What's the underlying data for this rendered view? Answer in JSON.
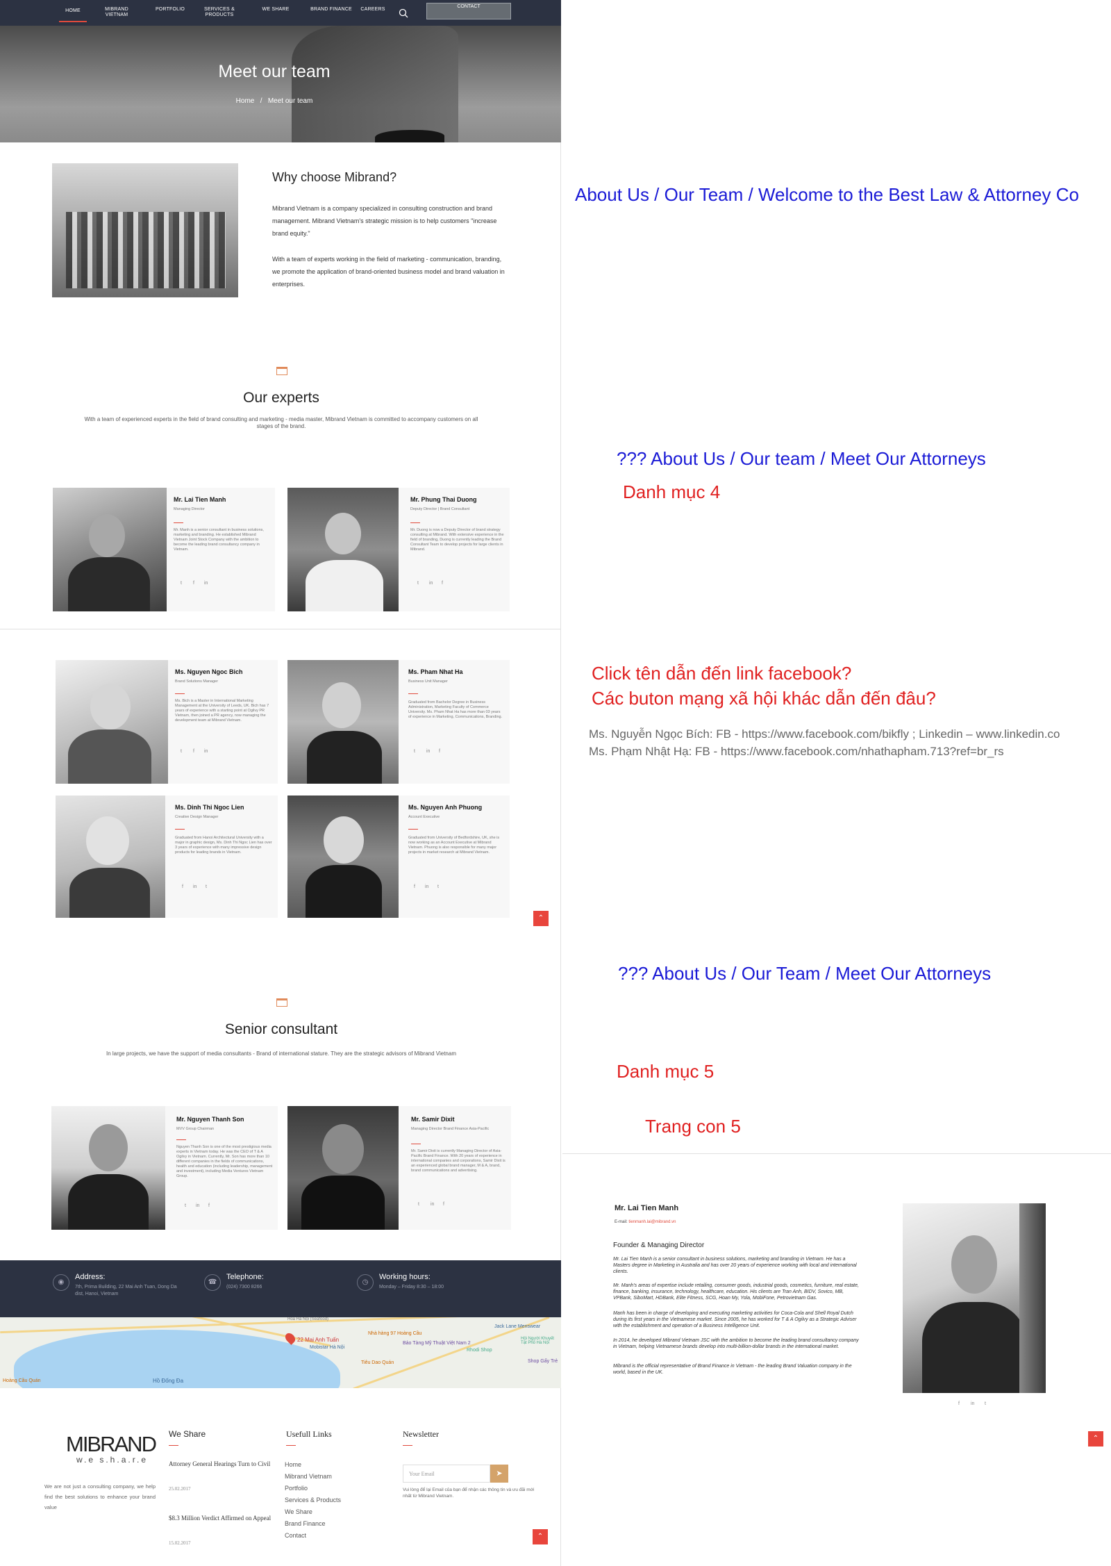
{
  "nav": {
    "items": [
      "HOME",
      "MIBRAND VIETNAM",
      "PORTFOLIO",
      "SERVICES & PRODUCTS",
      "WE SHARE",
      "BRAND FINANCE",
      "CAREERS"
    ],
    "contact": "CONTACT"
  },
  "hero": {
    "title": "Meet our team",
    "crumb_home": "Home",
    "crumb_sep": "/",
    "crumb_current": "Meet our team"
  },
  "why": {
    "title": "Why choose Mibrand?",
    "p1": "Mibrand Vietnam is a company specialized in consulting construction and brand management. Mibrand Vietnam's strategic mission is to help customers \"increase brand equity.\"",
    "p2": "With a team of experts working in the field of marketing - communication, branding, we promote the application of brand-oriented business model and brand valuation in enterprises."
  },
  "experts": {
    "title": "Our experts",
    "desc": "With a team of experienced experts in the field of brand consulting and marketing - media master, Mibrand Vietnam is committed to accompany customers on all stages of the brand.",
    "people": [
      {
        "name": "Mr. Lai Tien Manh",
        "role": "Managing Director",
        "bio": "Mr. Manh is a senior consultant in business solutions, marketing and branding. He established Mibrand Vietnam Joint Stock Company with the ambition to become the leading brand consultancy company in Vietnam.",
        "social": [
          "t",
          "f",
          "in"
        ]
      },
      {
        "name": "Mr. Phung Thai Duong",
        "role": "Deputy Director | Brand Consultant",
        "bio": "Mr. Duong is now a Deputy Director of brand strategy consulting at Mibrand. With extensive experience in the field of branding, Duong is currently leading the Brand Consultant Team to develop projects for large clients in Mibrand.",
        "social": [
          "t",
          "in",
          "f"
        ]
      },
      {
        "name": "Ms. Nguyen Ngoc Bich",
        "role": "Brand Solutions Manager",
        "bio": "Ms. Bich is a Master in International Marketing Management at the University of Leeds, UK. Bich has 7 years of experience with a starting point at Ogilvy PR Vietnam, then joined a PR agency, now managing the development team at Mibrand Vietnam.",
        "social": [
          "t",
          "f",
          "in"
        ]
      },
      {
        "name": "Ms. Pham Nhat Ha",
        "role": "Business Unit Manager",
        "bio": "Graduated from Bachelor Degree in Business Administration, Marketing Faculty of Commerce University. Ms. Pham Nhat Ha has more than 03 years of experience in Marketing, Communications, Branding.",
        "social": [
          "t",
          "in",
          "f"
        ]
      },
      {
        "name": "Ms. Dinh Thi Ngoc Lien",
        "role": "Creative Design Manager",
        "bio": "Graduated from Hanoi Architectural University with a major in graphic design, Ms. Dinh Thi Ngoc Lien has over 3 years of experience with many impressive design products for leading brands in Vietnam.",
        "social": [
          "f",
          "in",
          "t"
        ]
      },
      {
        "name": "Ms. Nguyen Anh Phuong",
        "role": "Account Executive",
        "bio": "Graduated from University of Bedfordshire, UK, she is now working as an Account Executive at Mibrand Vietnam. Phuong is also responsible for many major projects in market research at Mibrand Vietnam.",
        "social": [
          "f",
          "in",
          "t"
        ]
      }
    ]
  },
  "senior": {
    "title": "Senior consultant",
    "desc": "In large projects, we have the support of media consultants - Brand of international stature. They are the strategic advisors of Mibrand Vietnam",
    "people": [
      {
        "name": "Mr. Nguyen Thanh Son",
        "role": "MVV Group Chairman",
        "bio": "Nguyen Thanh Son is one of the most prestigious media experts in Vietnam today. He was the CEO of T & A Ogilvy in Vietnam. Currently, Mr. Son has more than 10 different companies in the fields of communications, health and education (including leadership, management and investment), including Media Ventures Vietnam Group.",
        "social": [
          "t",
          "in",
          "f"
        ]
      },
      {
        "name": "Mr. Samir Dixit",
        "role": "Managing Director Brand Finance Asia-Pacific",
        "bio": "Mr. Samir Dixit is currently Managing Director of Asia-Pacific Brand Finance. With 20 years of experience in international companies and corporations, Samir Dixit is an experienced global brand manager, M & A, brand, brand communications and advertising.",
        "social": [
          "t",
          "in",
          "f"
        ]
      }
    ]
  },
  "contact": {
    "address_title": "Address:",
    "address": "7th, Prima Building, 22 Mai Anh Tuan, Dong Da dist, Hanoi, Vietnam",
    "phone_title": "Telephone:",
    "phone": "(024) 7300 8266",
    "hours_title": "Working hours:",
    "hours": "Monday – Friday 8:30 – 18:00"
  },
  "map": {
    "lake": "Hồ Đống Đa",
    "pin": "22 Mai Anh Tuấn",
    "labels": [
      "Nhà hàng 97 Hoàng Cầu",
      "Bảo Tàng Mỹ Thuật Việt Nam 2",
      "Rhodi Shop",
      "Tiêu Dao Quán",
      "Mobistar Hà Nội",
      "Hoàng Cầu Quán",
      "Jack Lane Menswear",
      "Shop Gấy Trẻ",
      "Hội Người Khuyết Tật Phố Hà Nội",
      "Hoa Hà Nội (Seafood)"
    ]
  },
  "footer": {
    "logo": "MIBRAND",
    "logo_sub": "w.e s.h.a.r.e",
    "about": "We are not just a consulting company, we help find the best solutions to enhance your brand value",
    "we_share_title": "We Share",
    "posts": [
      {
        "title": "Attorney General Hearings Turn to Civil",
        "date": "25.02.2017"
      },
      {
        "title": "$8.3 Million Verdict Affirmed on Appeal",
        "date": "15.02.2017"
      }
    ],
    "links_title": "Usefull Links",
    "links": [
      "Home",
      "Mibrand Vietnam",
      "Portfolio",
      "Services & Products",
      "We Share",
      "Brand Finance",
      "Contact"
    ],
    "newsletter_title": "Newsletter",
    "newsletter_placeholder": "Your Email",
    "newsletter_note": "Vui lòng để lại Email của bạn để nhận các thông tin và ưu đãi mới nhất từ Mibrand Vietnam."
  },
  "notes": {
    "n1": "About Us / Our Team / Welcome to the Best Law & Attorney Co",
    "n2": "??? About Us / Our team /  Meet Our Attorneys",
    "n3": "Danh mục 4",
    "n4a": "Click tên dẫn đến link facebook?",
    "n4b": "Các buton mạng xã hội khác dẫn đến đâu?",
    "n5a": "Ms. Nguyễn Ngọc Bích: FB - https://www.facebook.com/bikfly ; Linkedin – www.linkedin.co",
    "n5b": "Ms. Phạm Nhật Hạ: FB - https://www.facebook.com/nhathapham.713?ref=br_rs",
    "n6": "??? About Us / Our Team / Meet Our Attorneys",
    "n7": "Danh mục 5",
    "n8": "Trang con 5"
  },
  "profile": {
    "name": "Mr. Lai Tien Manh",
    "email_label": "E-mail:",
    "email": "tienmanh.lai@mibrand.vn",
    "role": "Founder & Managing Director",
    "paras": [
      "Mr. Lai Tien Manh is a senior consultant in business solutions, marketing and branding in Vietnam. He has a Masters degree in Marketing in Australia and has over 20 years of experience working with local and international clients.",
      "Mr. Manh's areas of expertise include retailing, consumer goods, industrial goods, cosmetics, furniture, real estate, finance, banking, insurance, technology, healthcare, education. His clients are Tran Anh, BIDV, Sovico, MB, VPBank, SiboMart, HDBank, Elite Fitness, SCG, Hoan My, Yola, MobiFone, Petrovietnam Gas.",
      "Manh has been in charge of developing and executing marketing activities for Coca-Cola and Shell Royal Dutch during its first years in the Vietnamese market. Since 2005, he has worked for T & A Ogilvy as a Strategic Adviser with the establishment and operation of a Business Intelligence Unit.",
      "In 2014, he developed Mibrand Vietnam JSC with the ambition to become the leading brand consultancy company in Vietnam, helping Vietnamese brands develop into multi-billion-dollar brands in the international market.",
      "Mibrand is the official representative of Brand Finance in Vietnam - the leading Brand Valuation company in the world, based in the UK."
    ],
    "social": [
      "f",
      "in",
      "t"
    ]
  }
}
